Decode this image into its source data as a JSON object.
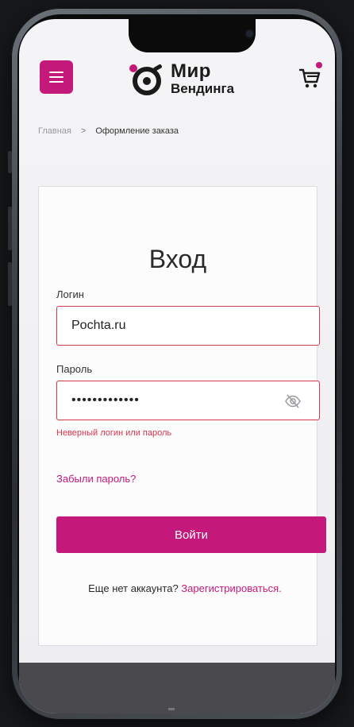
{
  "header": {
    "logo_line1": "Мир",
    "logo_line2": "Вендинга"
  },
  "breadcrumb": {
    "home": "Главная",
    "separator": ">",
    "current": "Оформление заказа"
  },
  "login": {
    "title": "Вход",
    "login_label": "Логин",
    "login_value": "Pochta.ru",
    "password_label": "Пароль",
    "password_value": "•••••••••••••",
    "error": "Неверный логин или пароль",
    "forgot": "Забыли пароль?",
    "submit": "Войти",
    "register_prompt": "Еще нет аккаунта?",
    "register_link": "Зарегистрироваться."
  },
  "colors": {
    "accent": "#c4187a",
    "error": "#d6354e",
    "background": "#17181b"
  },
  "icons": {
    "menu": "hamburger-icon",
    "cart": "cart-icon",
    "eye": "eye-off-icon"
  }
}
